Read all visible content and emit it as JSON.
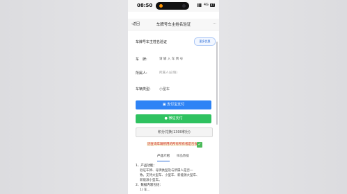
{
  "status_bar": {
    "time": "08:50",
    "signal": "4G",
    "battery": "47"
  },
  "nav": {
    "back_label": "返回",
    "title": "车牌号车主姓名验证",
    "more": "···"
  },
  "form": {
    "section_title": "车牌号车主姓名验证",
    "promo_button": "更多优惠",
    "plate_label": "车　牌:",
    "plate_placeholder": "请 输 入 车 牌 号",
    "owner_label": "所属人:",
    "owner_placeholder": "所属人(必填)",
    "vehicle_label": "车辆类型:",
    "vehicle_value": "小型车"
  },
  "buttons": {
    "alipay": "支付宝支付",
    "wechat": "微信支付",
    "points": "积分兑换(1300积分)"
  },
  "promo_text": "因查询车辆所用的所有所有者是否会",
  "tabs": [
    {
      "label": "产品介绍"
    },
    {
      "label": "样品数据"
    }
  ],
  "intro": {
    "item1_heading": "1、产品功能：",
    "item1_lines": [
      "验证车牌、号牌类型及与所属人是否一",
      "致。支持大型车、小型车、新能源大型车、",
      "新能源小型车。"
    ],
    "item2_heading": "2、数据内容包括：",
    "item2_lines": [
      "1) 车..."
    ]
  },
  "colors": {
    "alipay": "#2e83f5",
    "wechat": "#2fc260",
    "promo_red": "#d21b1b",
    "accent_blue": "#2b6bd6"
  }
}
